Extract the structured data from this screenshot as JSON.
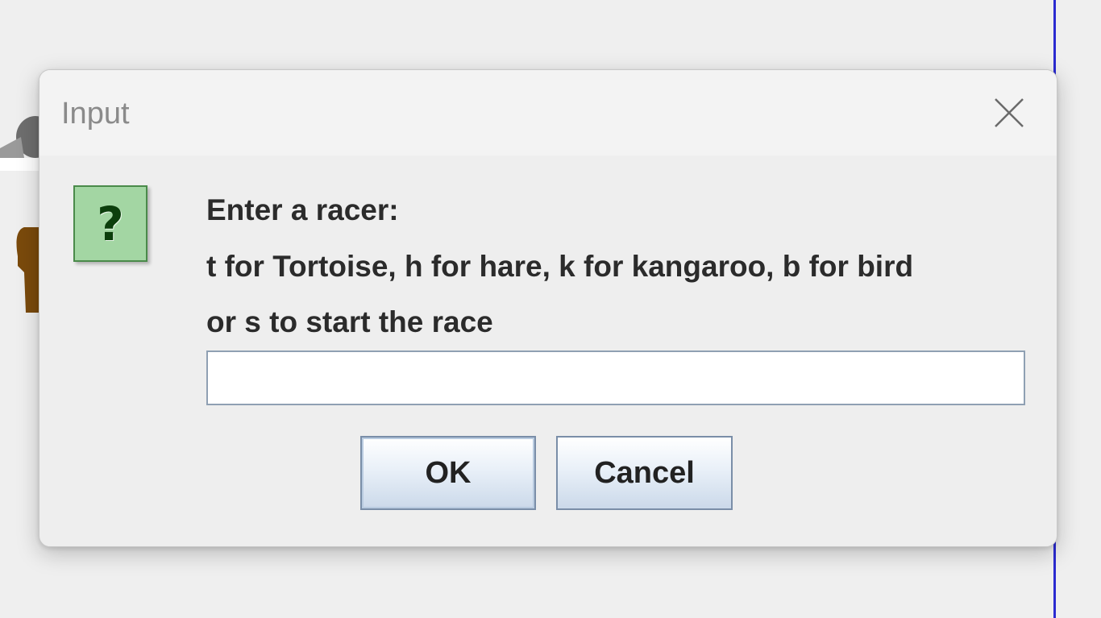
{
  "dialog": {
    "title": "Input",
    "message_lines": [
      "Enter a racer:",
      "t for Tortoise, h for hare, k for kangaroo, b for bird",
      "or s to start the race"
    ],
    "input": {
      "value": "",
      "placeholder": ""
    },
    "buttons": {
      "ok_label": "OK",
      "cancel_label": "Cancel"
    },
    "icon": {
      "name": "question-icon",
      "glyph": "?"
    }
  }
}
